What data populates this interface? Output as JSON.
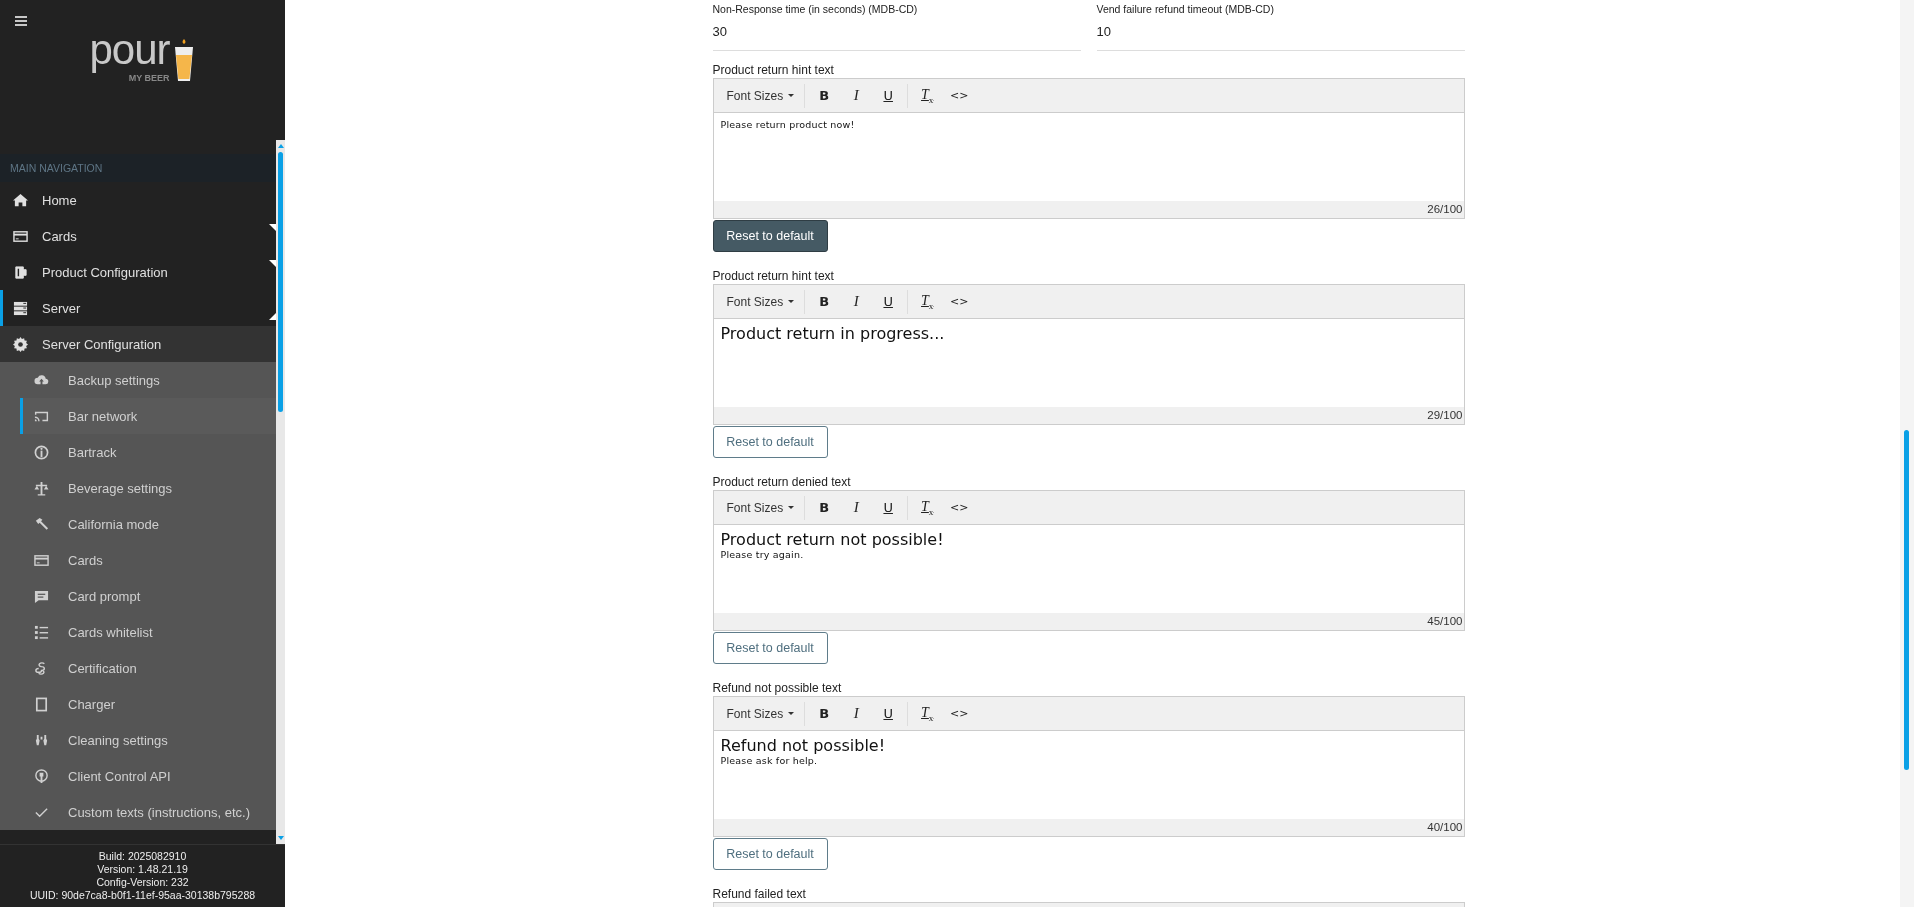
{
  "sidebar": {
    "logo": {
      "word": "pour",
      "tagline": "MY BEER"
    },
    "section_title": "MAIN NAVIGATION",
    "items": [
      {
        "label": "Home",
        "kind": "link",
        "selected": false
      },
      {
        "label": "Cards",
        "kind": "group",
        "expanded": false,
        "selected": false
      },
      {
        "label": "Product Configuration",
        "kind": "group",
        "expanded": false,
        "selected": false
      },
      {
        "label": "Server",
        "kind": "group",
        "expanded": true,
        "selected": true,
        "children": [
          {
            "label": "Server Configuration",
            "expanded": true,
            "children": [
              {
                "label": "Backup settings",
                "selected": false
              },
              {
                "label": "Bar network",
                "selected": true
              },
              {
                "label": "Bartrack",
                "selected": false
              },
              {
                "label": "Beverage settings",
                "selected": false
              },
              {
                "label": "California mode",
                "selected": false
              },
              {
                "label": "Cards",
                "selected": false
              },
              {
                "label": "Card prompt",
                "selected": false
              },
              {
                "label": "Cards whitelist",
                "selected": false
              },
              {
                "label": "Certification",
                "selected": false
              },
              {
                "label": "Charger",
                "selected": false
              },
              {
                "label": "Cleaning settings",
                "selected": false
              },
              {
                "label": "Client Control API",
                "selected": false
              },
              {
                "label": "Custom texts (instructions, etc.)",
                "selected": false
              }
            ]
          }
        ]
      }
    ],
    "footer": [
      "Build: 2025082910",
      "Version: 1.48.21.19",
      "Config-Version: 232",
      "UUID: 90de7ca8-b0f1-11ef-95aa-30138b795288"
    ]
  },
  "fields": [
    {
      "label": "Non-Response time (in seconds) (MDB-CD)",
      "value": "30"
    },
    {
      "label": "Vend failure refund timeout (MDB-CD)",
      "value": "10"
    }
  ],
  "editors": [
    {
      "label": "Product return hint text",
      "font_sizes": "Font Sizes",
      "tools": [
        {
          "kind": "bold",
          "label": "B"
        },
        {
          "kind": "italic",
          "label": "I"
        },
        {
          "kind": "underline",
          "label": "U"
        },
        {
          "kind": "clear",
          "label": "T$_{x}$"
        },
        {
          "kind": "code",
          "label": "<>"
        }
      ],
      "lines": [
        {
          "text": "Please return product now!",
          "kind": "small"
        }
      ],
      "count": "26/100",
      "reset": {
        "label": "Reset to default",
        "focused": true
      }
    },
    {
      "label": "Product return hint text",
      "font_sizes": "Font Sizes",
      "tools": [
        {
          "kind": "bold",
          "label": "B"
        },
        {
          "kind": "italic",
          "label": "I"
        },
        {
          "kind": "underline",
          "label": "U"
        },
        {
          "kind": "clear",
          "label": "T$_{x}$"
        },
        {
          "kind": "code",
          "label": "<>"
        }
      ],
      "lines": [
        {
          "text": "Product return in progress...",
          "kind": "large"
        }
      ],
      "count": "29/100",
      "reset": {
        "label": "Reset to default",
        "focused": false
      }
    },
    {
      "label": "Product return denied text",
      "font_sizes": "Font Sizes",
      "tools": [
        {
          "kind": "bold",
          "label": "B"
        },
        {
          "kind": "italic",
          "label": "I"
        },
        {
          "kind": "underline",
          "label": "U"
        },
        {
          "kind": "clear",
          "label": "T$_{x}$"
        },
        {
          "kind": "code",
          "label": "<>"
        }
      ],
      "lines": [
        {
          "text": "Product return not possible!",
          "kind": "large"
        },
        {
          "text": "Please try again.",
          "kind": "small"
        }
      ],
      "count": "45/100",
      "reset": {
        "label": "Reset to default",
        "focused": false
      }
    },
    {
      "label": "Refund not possible text",
      "font_sizes": "Font Sizes",
      "tools": [
        {
          "kind": "bold",
          "label": "B"
        },
        {
          "kind": "italic",
          "label": "I"
        },
        {
          "kind": "underline",
          "label": "U"
        },
        {
          "kind": "clear",
          "label": "T$_{x}$"
        },
        {
          "kind": "code",
          "label": "<>"
        }
      ],
      "lines": [
        {
          "text": "Refund not possible!",
          "kind": "large"
        },
        {
          "text": "Please ask for help.",
          "kind": "small"
        }
      ],
      "count": "40/100",
      "reset": {
        "label": "Reset to default",
        "focused": false
      }
    },
    {
      "label": "Refund failed text"
    }
  ]
}
